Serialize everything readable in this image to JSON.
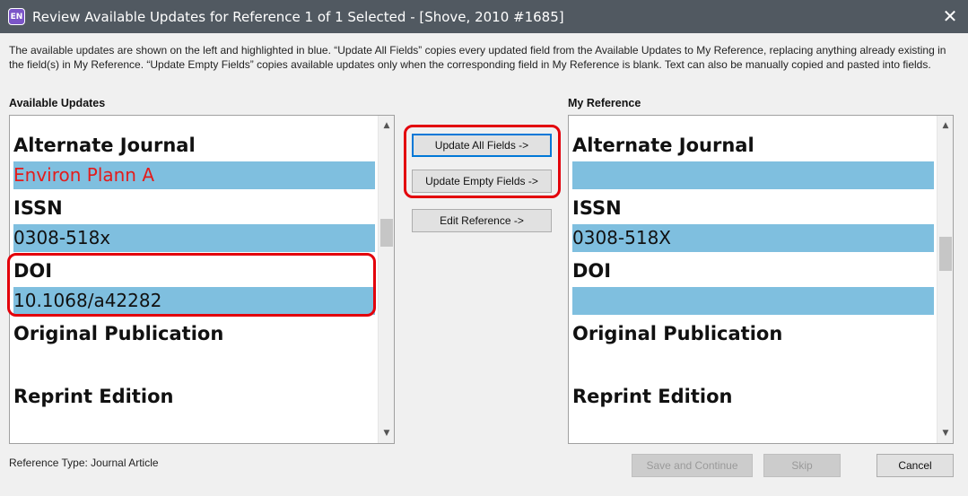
{
  "window": {
    "app_icon_text": "EN",
    "title": "Review Available Updates for Reference 1 of 1 Selected - [Shove, 2010 #1685]",
    "close_glyph": "✕"
  },
  "instructions": "The available updates are shown on the left and highlighted in blue. “Update All Fields” copies every updated field from the Available Updates to My Reference, replacing anything already existing in the field(s) in My Reference. “Update Empty Fields” copies available updates only when the corresponding field in My Reference is blank. Text can also be manually copied and pasted into fields.",
  "left_panel": {
    "label": "Available Updates",
    "fields": [
      {
        "label": "Alternate Journal",
        "value": "Environ Plann A",
        "highlighted": true
      },
      {
        "label": "ISSN",
        "value": "0308-518x",
        "highlighted": true
      },
      {
        "label": "DOI",
        "value": "10.1068/a42282",
        "highlighted": true
      },
      {
        "label": "Original Publication",
        "value": "",
        "highlighted": false
      },
      {
        "label": "Reprint Edition",
        "value": "",
        "highlighted": false
      }
    ]
  },
  "right_panel": {
    "label": "My Reference",
    "fields": [
      {
        "label": "Alternate Journal",
        "value": "",
        "highlighted": true
      },
      {
        "label": "ISSN",
        "value": "0308-518X",
        "highlighted": true
      },
      {
        "label": "DOI",
        "value": "",
        "highlighted": true
      },
      {
        "label": "Original Publication",
        "value": "",
        "highlighted": false
      },
      {
        "label": "Reprint Edition",
        "value": "",
        "highlighted": false
      }
    ]
  },
  "buttons": {
    "update_all": "Update All Fields ->",
    "update_empty": "Update Empty Fields ->",
    "edit_reference": "Edit Reference ->",
    "save_continue": "Save and Continue",
    "skip": "Skip",
    "cancel": "Cancel"
  },
  "reference_type": "Reference Type: Journal Article",
  "scroll": {
    "up_glyph": "▲",
    "down_glyph": "▼"
  },
  "colors": {
    "titlebar": "#515961",
    "highlight_fill": "#7fbfdf",
    "annotation_red": "#e3000b",
    "update_value_red": "#e31c1c"
  }
}
